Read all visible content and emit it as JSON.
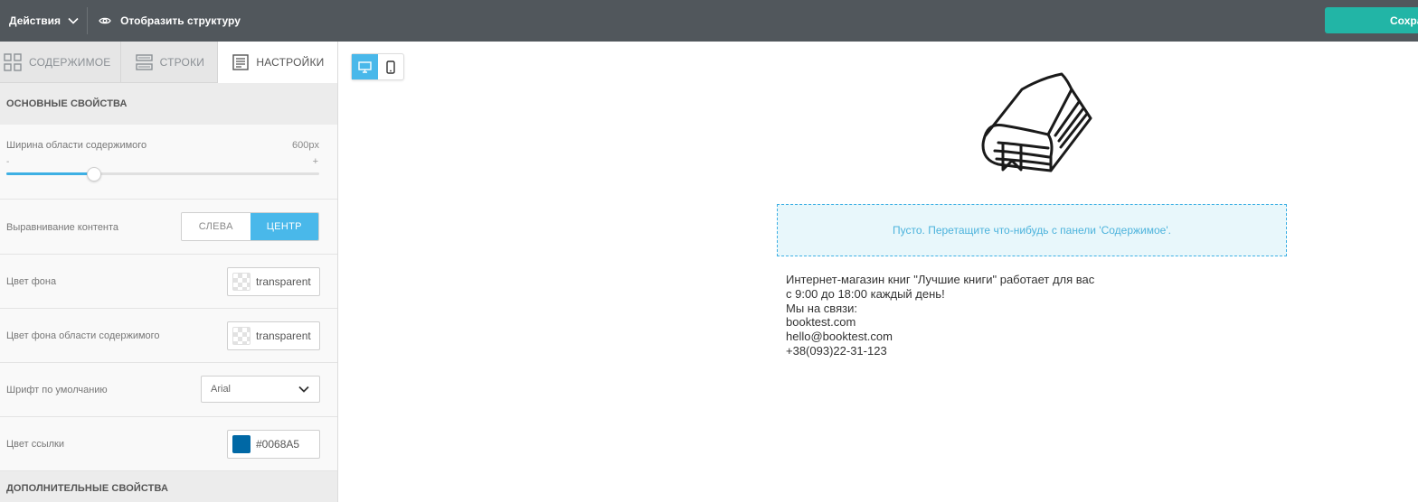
{
  "topbar": {
    "actions_label": "Действия",
    "structure_label": "Отобразить структуру",
    "save_label": "Сохра"
  },
  "tabs": [
    {
      "label": "СОДЕРЖИМОЕ",
      "icon": "grid-icon",
      "active": false
    },
    {
      "label": "СТРОКИ",
      "icon": "rows-icon",
      "active": false
    },
    {
      "label": "НАСТРОЙКИ",
      "icon": "settings-doc-icon",
      "active": true
    }
  ],
  "settings": {
    "main_section_title": "ОСНОВНЫЕ СВОЙСТВА",
    "content_width": {
      "label": "Ширина области содержимого",
      "value": "600px",
      "min_symbol": "-",
      "max_symbol": "+",
      "slider_fraction": 0.28
    },
    "alignment": {
      "label": "Выравнивание контента",
      "options": [
        "СЛЕВА",
        "ЦЕНТР"
      ],
      "selected": "ЦЕНТР"
    },
    "background_color": {
      "label": "Цвет фона",
      "value": "transparent"
    },
    "content_background_color": {
      "label": "Цвет фона области содержимого",
      "value": "transparent"
    },
    "default_font": {
      "label": "Шрифт по умолчанию",
      "value": "Arial"
    },
    "link_color": {
      "label": "Цвет ссылки",
      "value": "#0068A5"
    },
    "extra_section_title": "ДОПОЛНИТЕЛЬНЫЕ СВОЙСТВА"
  },
  "canvas": {
    "drop_zone_text": "Пусто. Перетащите что-нибудь с панели 'Содержимое'.",
    "info_lines": [
      "Интернет-магазин книг \"Лучшие книги\" работает для вас",
      "с 9:00 до 18:00 каждый день!",
      "Мы на связи:",
      "booktest.com",
      "hello@booktest.com",
      "+38(093)22-31-123"
    ]
  },
  "colors": {
    "topbar": "#51575c",
    "save_button": "#22b5a6",
    "accent": "#49b8ea",
    "link": "#0068A5"
  }
}
